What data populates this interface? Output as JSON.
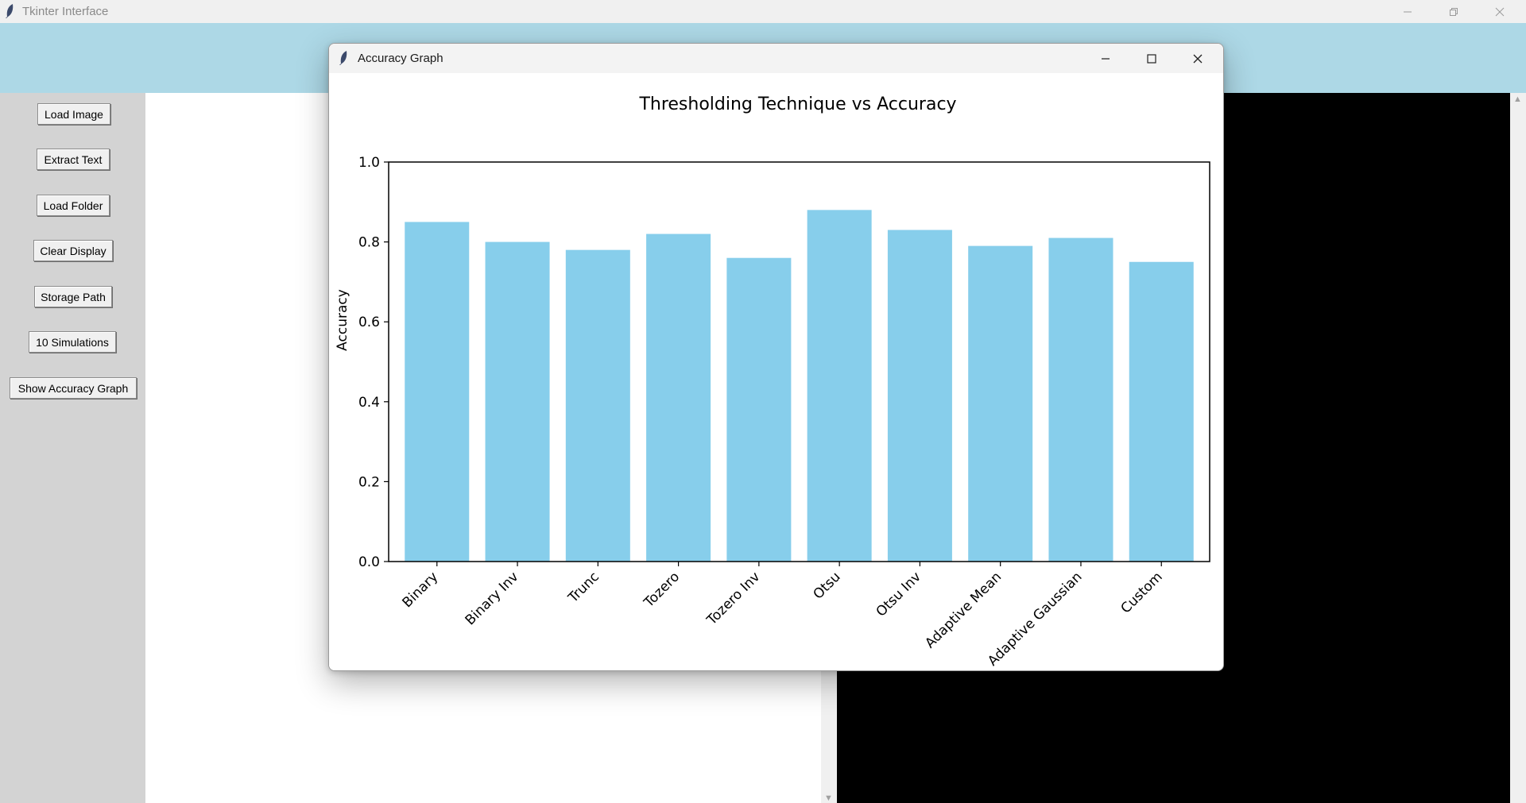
{
  "window": {
    "title": "Tkinter Interface"
  },
  "sidebar": {
    "buttons": [
      {
        "label": "Load Image"
      },
      {
        "label": "Extract Text"
      },
      {
        "label": "Load Folder"
      },
      {
        "label": "Clear Display"
      },
      {
        "label": "Storage Path"
      },
      {
        "label": "10 Simulations"
      },
      {
        "label": "Show Accuracy Graph"
      }
    ]
  },
  "colors": {
    "top_band": "#add8e6",
    "sidebar": "#d3d3d3",
    "bar": "#87ceeb"
  },
  "popup": {
    "title": "Accuracy Graph"
  },
  "chart_data": {
    "type": "bar",
    "title": "Thresholding Technique vs Accuracy",
    "xlabel": "",
    "ylabel": "Accuracy",
    "categories": [
      "Binary",
      "Binary Inv",
      "Trunc",
      "Tozero",
      "Tozero Inv",
      "Otsu",
      "Otsu Inv",
      "Adaptive Mean",
      "Adaptive Gaussian",
      "Custom"
    ],
    "values": [
      0.85,
      0.8,
      0.78,
      0.82,
      0.76,
      0.88,
      0.83,
      0.79,
      0.81,
      0.75
    ],
    "ylim": [
      0,
      1.0
    ],
    "yticks": [
      "0.0",
      "0.2",
      "0.4",
      "0.6",
      "0.8",
      "1.0"
    ],
    "grid": false,
    "bar_color": "#87ceeb"
  }
}
